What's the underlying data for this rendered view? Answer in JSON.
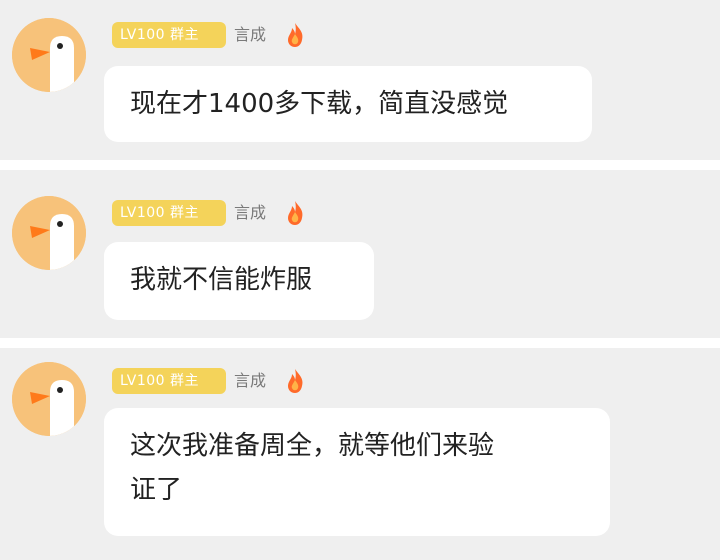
{
  "messages": [
    {
      "badge": "LV100 群主",
      "name": "言成",
      "text": "现在才1400多下载，简直没感觉"
    },
    {
      "badge": "LV100 群主",
      "name": "言成",
      "text": "我就不信能炸服"
    },
    {
      "badge": "LV100 群主",
      "name": "言成",
      "text": "这次我准备周全，就等他们来验\n证了"
    }
  ],
  "colors": {
    "background": "#efefef",
    "divider": "#ffffff",
    "badge": "#f4d35a",
    "avatar": "#f7c27a",
    "bubble": "#ffffff"
  },
  "icons": {
    "avatar": "goose-avatar-icon",
    "fire": "fire-icon"
  }
}
